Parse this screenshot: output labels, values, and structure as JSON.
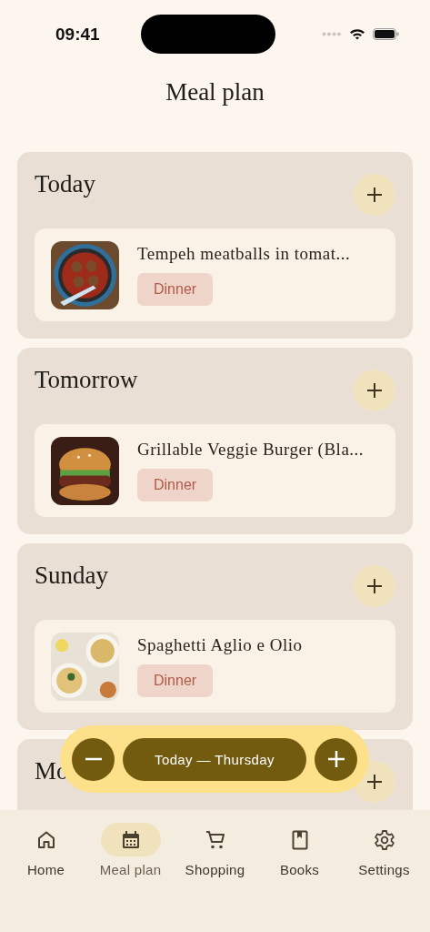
{
  "status_bar": {
    "time": "09:41"
  },
  "title": "Meal plan",
  "days": [
    {
      "title": "Today",
      "meals": [
        {
          "name": "Tempeh meatballs in tomat...",
          "tag": "Dinner",
          "kind": "picture"
        }
      ]
    },
    {
      "title": "Tomorrow",
      "meals": [
        {
          "name": "Grillable Veggie Burger (Bla...",
          "tag": "Dinner",
          "kind": "picture"
        }
      ]
    },
    {
      "title": "Sunday",
      "meals": [
        {
          "name": "Spaghetti Aglio e Olio",
          "tag": "Dinner",
          "kind": "picture"
        }
      ]
    },
    {
      "title": "Mo"
    }
  ],
  "day_picker": {
    "label": "Today — Thursday"
  },
  "nav": [
    {
      "label": "Home",
      "selected": false
    },
    {
      "label": "Meal plan",
      "selected": true
    },
    {
      "label": "Shopping",
      "selected": false
    },
    {
      "label": "Books",
      "selected": false
    },
    {
      "label": "Settings",
      "selected": false
    }
  ]
}
